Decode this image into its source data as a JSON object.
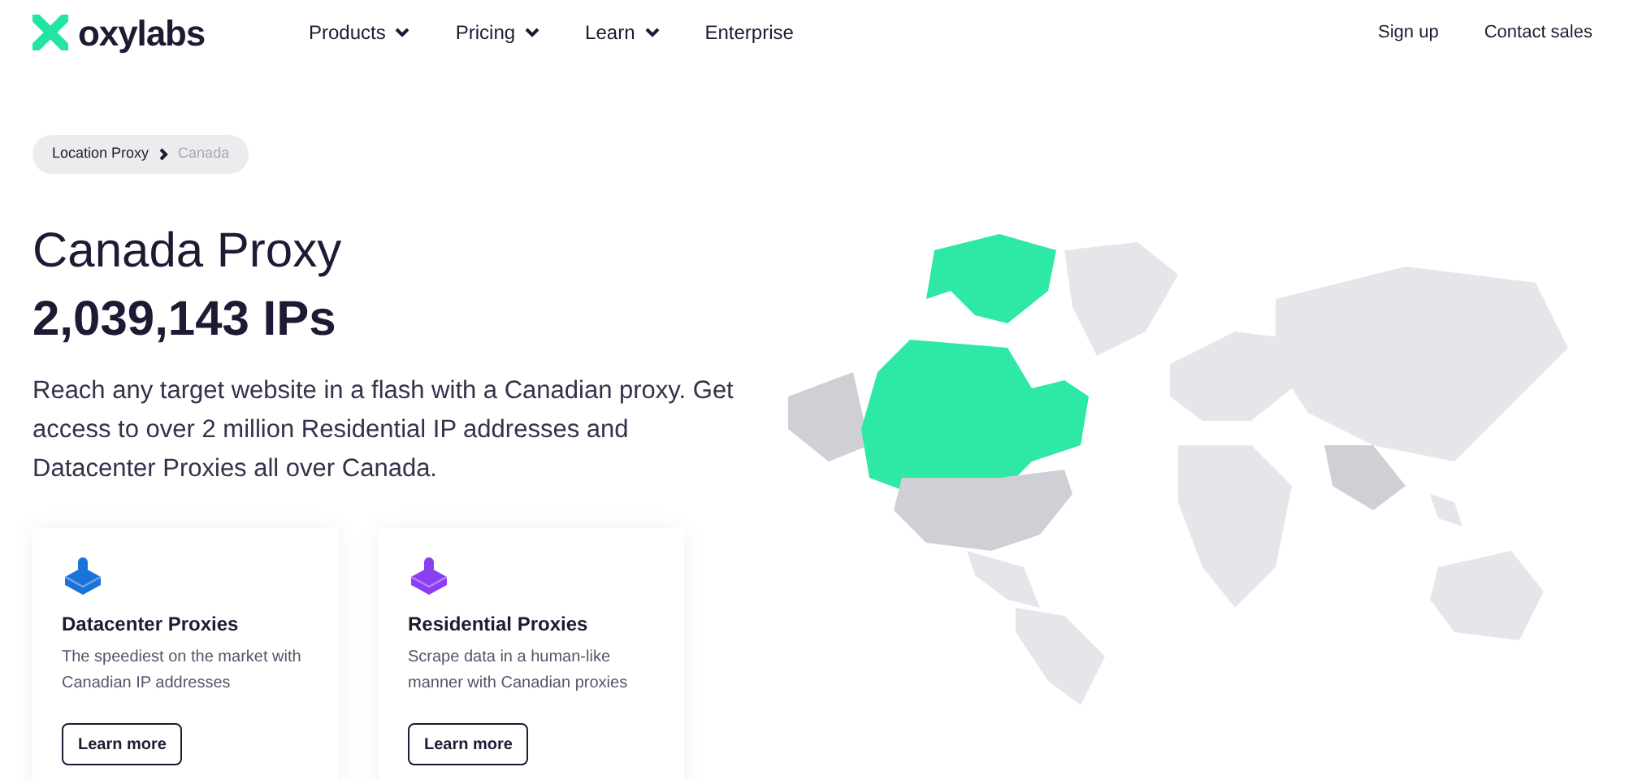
{
  "logo": {
    "text": "oxylabs"
  },
  "nav": [
    {
      "label": "Products",
      "dropdown": true
    },
    {
      "label": "Pricing",
      "dropdown": true
    },
    {
      "label": "Learn",
      "dropdown": true
    },
    {
      "label": "Enterprise",
      "dropdown": false
    }
  ],
  "nav_right": [
    "Sign up",
    "Contact sales"
  ],
  "breadcrumb": [
    {
      "label": "Location Proxy",
      "selected": false
    },
    {
      "label": "Canada",
      "selected": true
    }
  ],
  "title": "Canada Proxy",
  "ip_count": "2,039,143 IPs",
  "description": "Reach any target website in a flash with a Canadian proxy. Get access to over 2 million Residential IP addresses and Datacenter Proxies all over Canada.",
  "cards": [
    {
      "title": "Datacenter Proxies",
      "text": "The speediest on the market with Canadian IP addresses",
      "button": "Learn more",
      "color": "#1a73d9"
    },
    {
      "title": "Residential Proxies",
      "text": "Scrape data in a human-like manner with Canadian proxies",
      "button": "Learn more",
      "color": "#8a3ff0"
    }
  ]
}
